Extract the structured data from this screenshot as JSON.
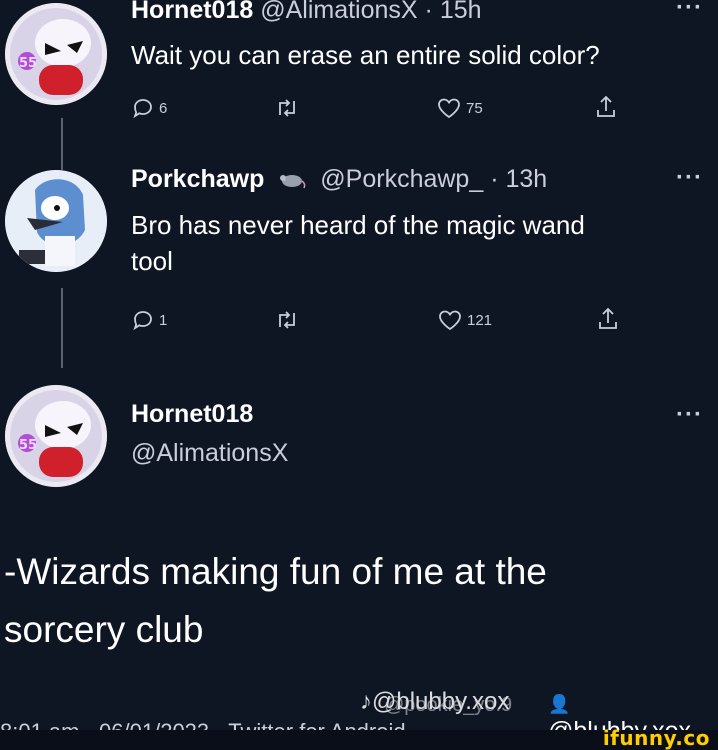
{
  "tweets": [
    {
      "name": "Hornet018",
      "handle": "@AlimationsX",
      "time": "· 15h",
      "text": "Wait you can erase an entire solid color?",
      "replies": "6",
      "retweets": "",
      "likes": "75",
      "avatar_icon": "cartoon-avatar-icon"
    },
    {
      "name": "Porkchawp",
      "badge_icon": "rat-emoji-icon",
      "handle": "@Porkchawp_",
      "time": "· 13h",
      "text_lines": [
        "Bro has never heard of the magic wand",
        "tool"
      ],
      "replies": "1",
      "retweets": "",
      "likes": "121",
      "avatar_icon": "mordecai-avatar-icon"
    }
  ],
  "quote": {
    "name": "Hornet018",
    "handle": "@AlimationsX",
    "text_lines": [
      "-Wizards making fun of me at the",
      "sorcery club"
    ]
  },
  "more_label": "···",
  "watermark": {
    "tiktok_handle": "@blubby.xox",
    "overlap_handle": "@pookie_yo.9",
    "user_handle": "@blubby.xox",
    "footer_text": "8:01 am · 06/01/2023 · Twitter for Android"
  },
  "brand": "ifunny.co",
  "colors": {
    "background": "#0e1523",
    "text": "#ffffff",
    "secondary": "#c9ced8",
    "brand": "#ffcc00"
  }
}
